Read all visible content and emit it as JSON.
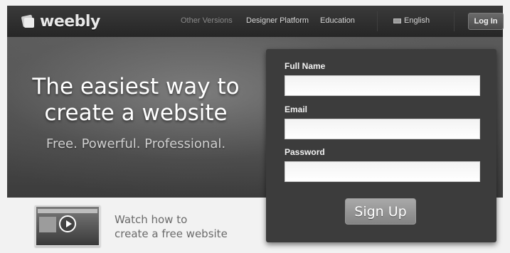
{
  "header": {
    "logo_text": "weebly",
    "nav": {
      "other_versions": "Other Versions",
      "designer_platform": "Designer Platform",
      "education": "Education"
    },
    "language": "English",
    "login_label": "Log In"
  },
  "hero": {
    "headline_line1": "The easiest way to",
    "headline_line2": "create a website",
    "tagline": "Free. Powerful. Professional."
  },
  "signup": {
    "full_name_label": "Full Name",
    "full_name_value": "",
    "email_label": "Email",
    "email_value": "",
    "password_label": "Password",
    "password_value": "",
    "submit_label": "Sign Up"
  },
  "video": {
    "line1": "Watch how to",
    "line2": "create a free website"
  }
}
